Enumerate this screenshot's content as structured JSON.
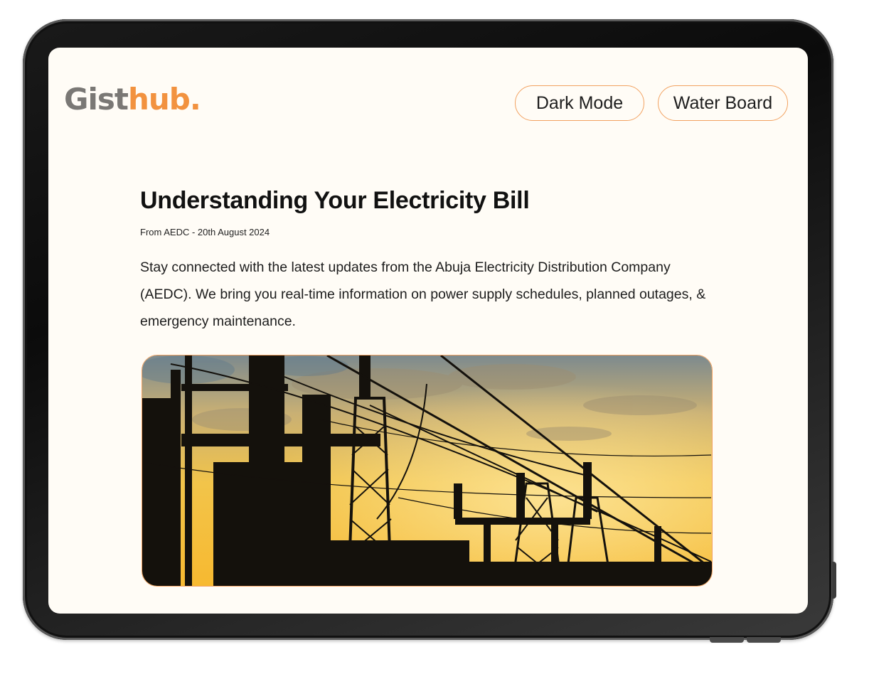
{
  "header": {
    "logo": {
      "part1": "Gist",
      "part2": "hub."
    },
    "buttons": {
      "dark_mode": "Dark Mode",
      "water_board": "Water Board"
    }
  },
  "article": {
    "title": "Understanding Your Electricity Bill",
    "meta": "From AEDC - 20th August 2024",
    "body": "Stay connected with the latest updates from the Abuja Electricity Distribution Company (AEDC). We bring you real-time information on power supply schedules, planned outages, & emergency maintenance."
  },
  "colors": {
    "accent": "#f2923f",
    "logo_gray": "#7a7875",
    "screen_bg": "#fffcf6"
  }
}
